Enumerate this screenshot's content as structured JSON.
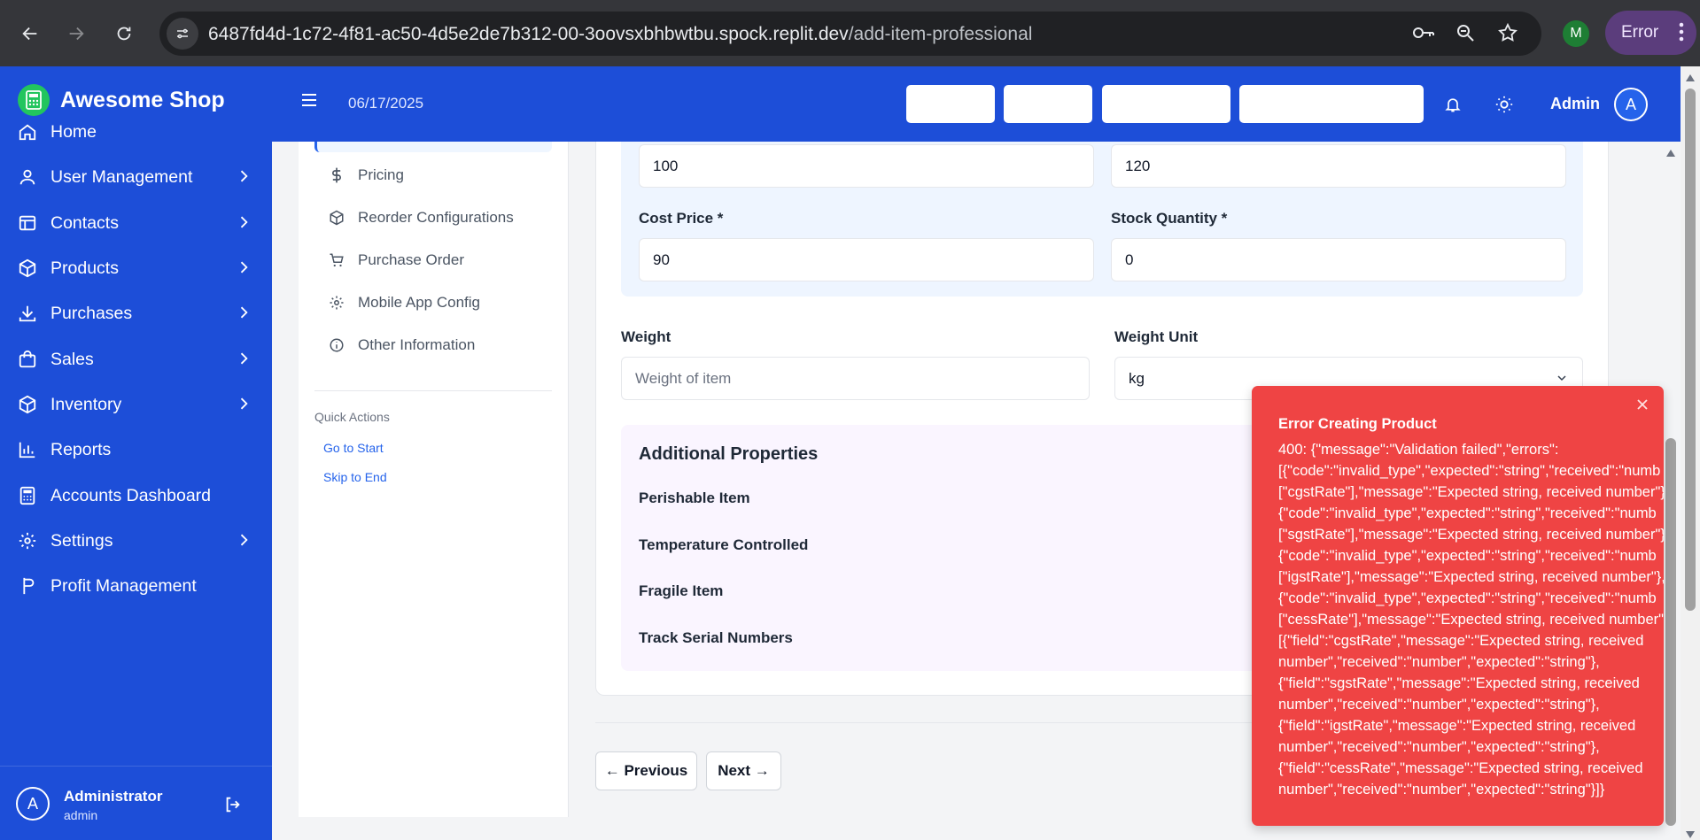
{
  "browser": {
    "url_host": "6487fd4d-1c72-4f81-ac50-4d5e2de7b312-00-3oovsxbhbwtbu.spock.replit.dev",
    "url_path": "/add-item-professional",
    "profile_initial": "M",
    "error_label": "Error"
  },
  "brand": {
    "name": "Awesome Shop"
  },
  "sidebar": {
    "items": [
      {
        "label": "Home"
      },
      {
        "label": "User Management"
      },
      {
        "label": "Contacts"
      },
      {
        "label": "Products"
      },
      {
        "label": "Purchases"
      },
      {
        "label": "Sales"
      },
      {
        "label": "Inventory"
      },
      {
        "label": "Reports"
      },
      {
        "label": "Accounts Dashboard"
      },
      {
        "label": "Settings"
      },
      {
        "label": "Profit Management"
      }
    ],
    "user": {
      "initial": "A",
      "name": "Administrator",
      "role": "admin"
    }
  },
  "header": {
    "date": "06/17/2025",
    "user_name": "Admin",
    "user_initial": "A"
  },
  "steps": {
    "items": [
      {
        "label": "Pricing"
      },
      {
        "label": "Reorder Configurations"
      },
      {
        "label": "Purchase Order"
      },
      {
        "label": "Mobile App Config"
      },
      {
        "label": "Other Information"
      }
    ],
    "quick_actions": {
      "title": "Quick Actions",
      "go_start": "Go to Start",
      "skip_end": "Skip to End"
    }
  },
  "form": {
    "top_left_value": "100",
    "top_right_value": "120",
    "cost_price": {
      "label": "Cost Price *",
      "value": "90"
    },
    "stock_quantity": {
      "label": "Stock Quantity *",
      "value": "0"
    },
    "weight": {
      "label": "Weight",
      "placeholder": "Weight of item"
    },
    "weight_unit": {
      "label": "Weight Unit",
      "value": "kg"
    },
    "additional": {
      "title": "Additional Properties",
      "perishable": "Perishable Item",
      "temperature": "Temperature Controlled",
      "fragile": "Fragile Item",
      "serial": "Track Serial Numbers"
    },
    "prev_label": "← Previous",
    "next_label": "Next →"
  },
  "toast": {
    "title": "Error Creating Product",
    "message": "400: {\"message\":\"Validation failed\",\"errors\":\n[{\"code\":\"invalid_type\",\"expected\":\"string\",\"received\":\"numb\n[\"cgstRate\"],\"message\":\"Expected string, received number\"}\n{\"code\":\"invalid_type\",\"expected\":\"string\",\"received\":\"numb\n[\"sgstRate\"],\"message\":\"Expected string, received number\"}\n{\"code\":\"invalid_type\",\"expected\":\"string\",\"received\":\"numb\n[\"igstRate\"],\"message\":\"Expected string, received number\"},\n{\"code\":\"invalid_type\",\"expected\":\"string\",\"received\":\"numb\n[\"cessRate\"],\"message\":\"Expected string, received number\"}\n[{\"field\":\"cgstRate\",\"message\":\"Expected string, received\nnumber\",\"received\":\"number\",\"expected\":\"string\"},\n{\"field\":\"sgstRate\",\"message\":\"Expected string, received\nnumber\",\"received\":\"number\",\"expected\":\"string\"},\n{\"field\":\"igstRate\",\"message\":\"Expected string, received\nnumber\",\"received\":\"number\",\"expected\":\"string\"},\n{\"field\":\"cessRate\",\"message\":\"Expected string, received\nnumber\",\"received\":\"number\",\"expected\":\"string\"}]}"
  },
  "colors": {
    "primary": "#1d4ed8",
    "success": "#22c55e",
    "error": "#ef4444",
    "link": "#2563eb"
  }
}
